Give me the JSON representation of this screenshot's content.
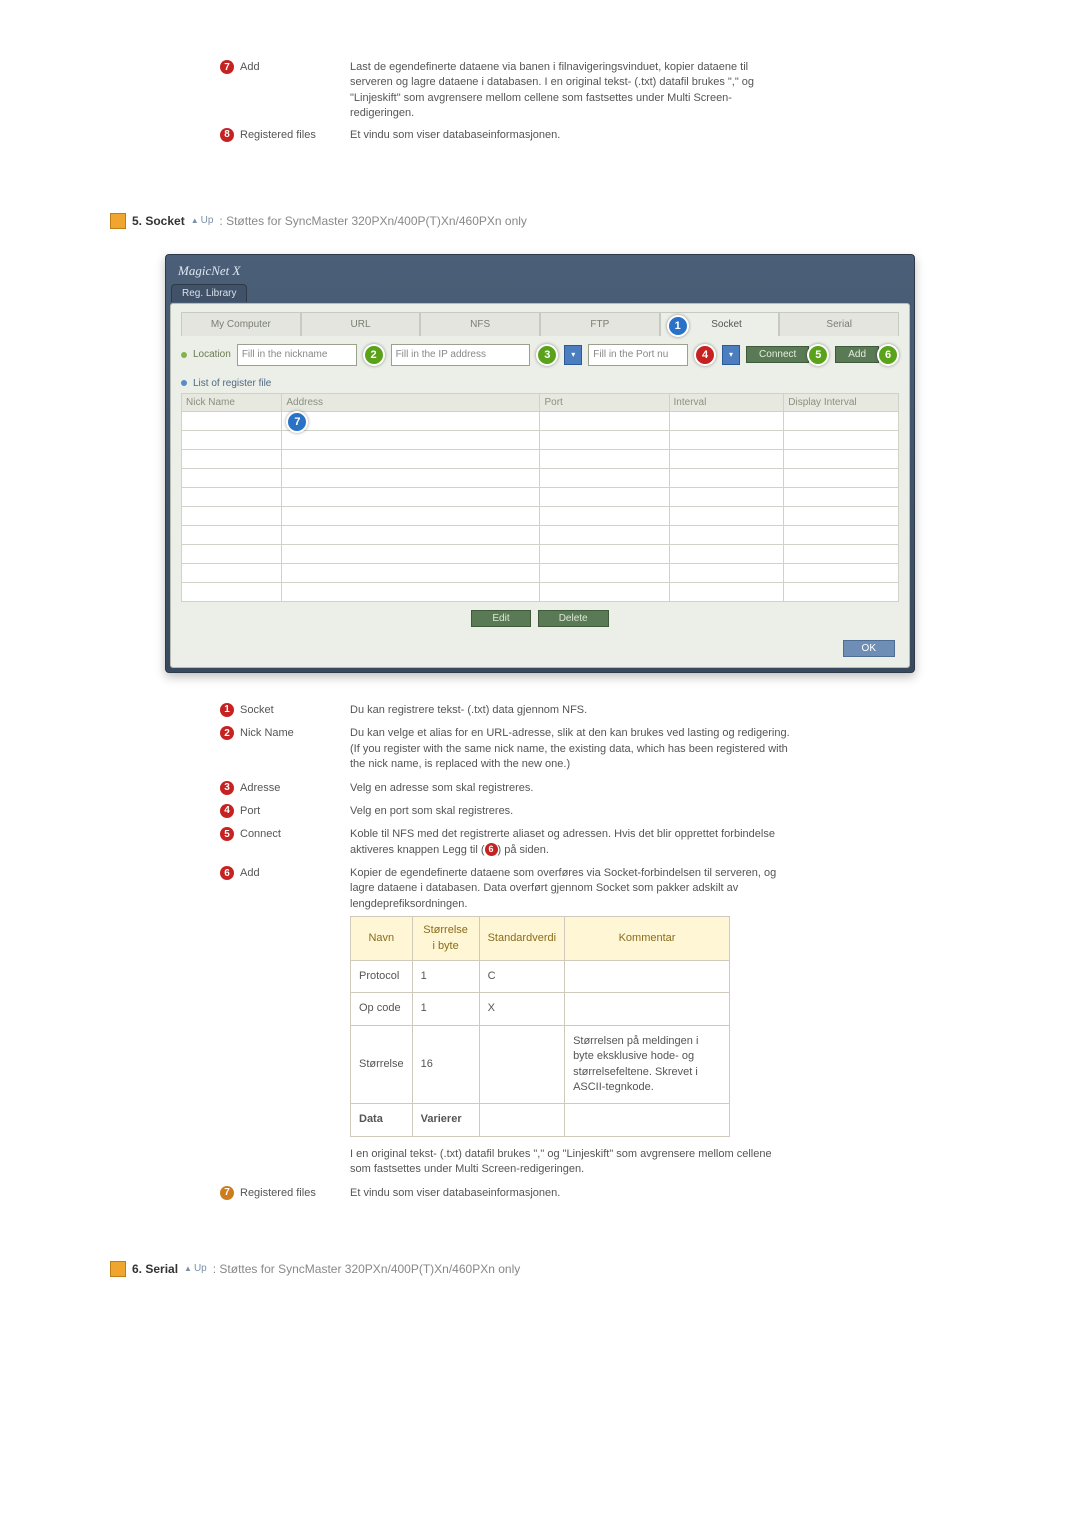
{
  "top_items": [
    {
      "num": "7",
      "color": "red",
      "label": "Add",
      "desc": "Last de egendefinerte dataene via banen i filnavigeringsvinduet, kopier dataene til serveren og lagre dataene i databasen. I en original tekst- (.txt) datafil brukes \",\" og \"Linjeskift\" som avgrensere mellom cellene som fastsettes under Multi Screen-redigeringen."
    },
    {
      "num": "8",
      "color": "red",
      "label": "Registered files",
      "desc": "Et vindu som viser databaseinformasjonen."
    }
  ],
  "section5": {
    "title": "5. Socket",
    "up": "Up",
    "note": ": Støttes for SyncMaster 320PXn/400P(T)Xn/460PXn only"
  },
  "app": {
    "title": "MagicNet X",
    "tab": "Reg. Library",
    "tabs": [
      "My Computer",
      "URL",
      "NFS",
      "FTP",
      "Socket",
      "Serial"
    ],
    "location_label": "Location",
    "nickname_ph": "Fill in the nickname",
    "ip_ph": "Fill in the IP address",
    "port_ph": "Fill in the Port nu",
    "connect": "Connect",
    "add": "Add",
    "list_title": "List of register file",
    "columns": [
      "Nick Name",
      "Address",
      "Port",
      "Interval",
      "Display Interval"
    ],
    "edit": "Edit",
    "delete": "Delete",
    "ok": "OK"
  },
  "defs": [
    {
      "num": "1",
      "color": "red",
      "label": "Socket",
      "desc": "Du kan registrere tekst- (.txt) data gjennom NFS."
    },
    {
      "num": "2",
      "color": "red",
      "label": "Nick Name",
      "desc": "Du kan velge et alias for en URL-adresse, slik at den kan brukes ved lasting og redigering. (If you register with the same nick name, the existing data, which has been registered with the nick name, is replaced with the new one.)"
    },
    {
      "num": "3",
      "color": "red",
      "label": "Adresse",
      "desc": "Velg en adresse som skal registreres."
    },
    {
      "num": "4",
      "color": "red",
      "label": "Port",
      "desc": "Velg en port som skal registreres."
    },
    {
      "num": "5",
      "color": "red",
      "label": "Connect",
      "desc": "Koble til NFS med det registrerte aliaset og adressen. Hvis det blir opprettet forbindelse aktiveres knappen Legg til (",
      "inline_num": "6",
      "inline_color": "red",
      "desc_tail": ") på siden."
    },
    {
      "num": "6",
      "color": "red",
      "label": "Add",
      "desc": "Kopier de egendefinerte dataene som overføres via Socket-forbindelsen til serveren, og lagre dataene i databasen. Data overført gjennom Socket som pakker adskilt av lengdeprefiksordningen."
    }
  ],
  "packet": {
    "headers": [
      "Navn",
      "Størrelse i byte",
      "Standardverdi",
      "Kommentar"
    ],
    "rows": [
      [
        "Protocol",
        "1",
        "C",
        ""
      ],
      [
        "Op code",
        "1",
        "X",
        ""
      ],
      [
        "Størrelse",
        "16",
        "",
        "Størrelsen på meldingen i byte eksklusive hode- og størrelsefeltene. Skrevet i ASCII-tegnkode."
      ],
      [
        "Data",
        "Varierer",
        "",
        ""
      ]
    ]
  },
  "after_table": "I en original tekst- (.txt) datafil brukes \",\" og \"Linjeskift\" som avgrensere mellom cellene som fastsettes under Multi Screen-redigeringen.",
  "reg_files": {
    "num": "7",
    "color": "orange",
    "label": "Registered files",
    "desc": "Et vindu som viser databaseinformasjonen."
  },
  "section6": {
    "title": "6. Serial",
    "up": "Up",
    "note": ": Støttes for SyncMaster 320PXn/400P(T)Xn/460PXn only"
  }
}
